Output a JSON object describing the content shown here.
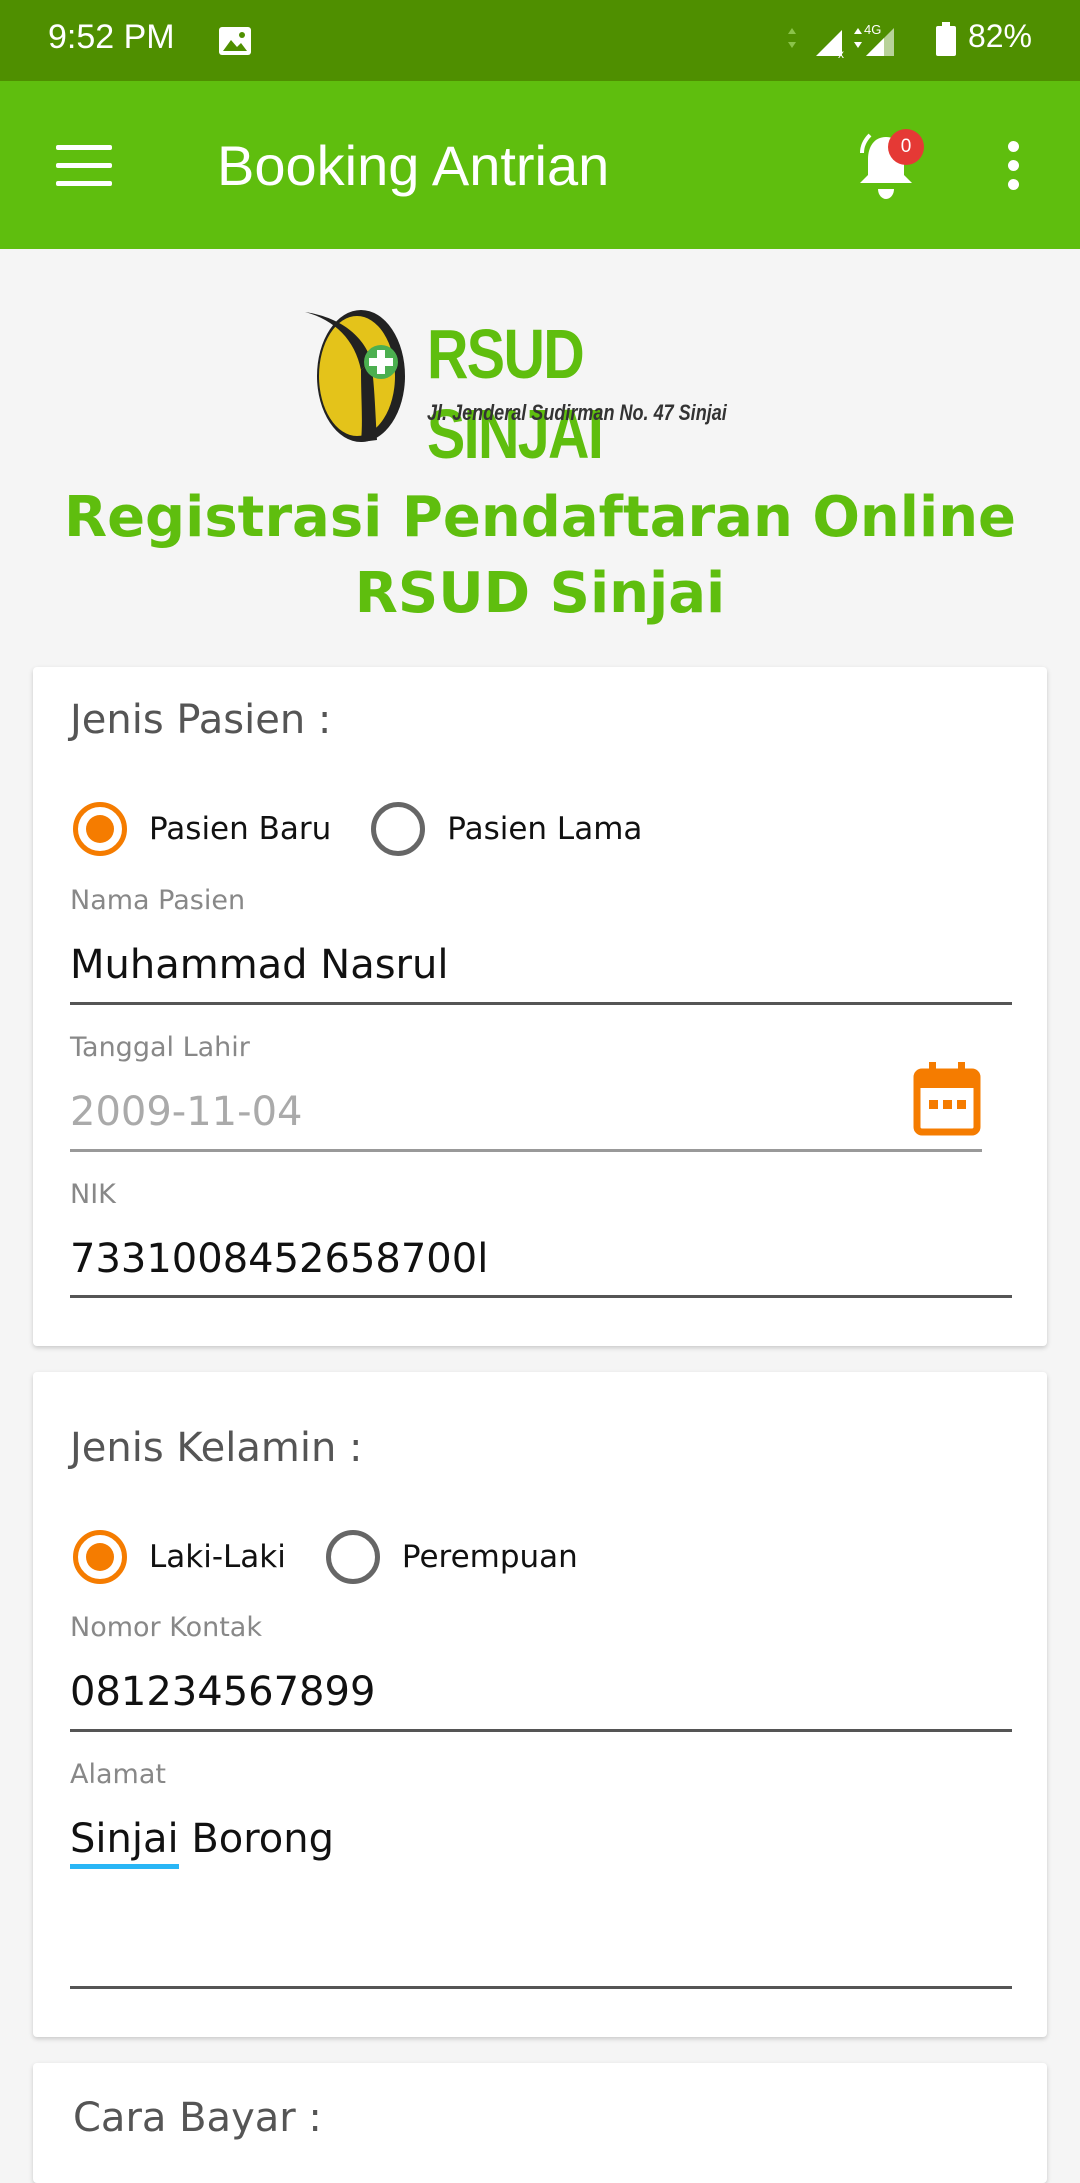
{
  "status_bar": {
    "time": "9:52 PM",
    "battery": "82%",
    "network": "4G",
    "icons": [
      "image-icon",
      "signal-icon",
      "battery-icon"
    ]
  },
  "app_bar": {
    "title": "Booking Antrian",
    "notification_count": "0",
    "icons": [
      "menu-icon",
      "bell-icon",
      "more-vert-icon"
    ]
  },
  "logo": {
    "name": "RSUD SINJAI",
    "address": "Jl. Jenderal Sudirman No. 47 Sinjai"
  },
  "heading": "Registrasi Pendaftaran Online RSUD Sinjai",
  "colors": {
    "primary": "#5fbe0e",
    "status_bar": "#4f8f00",
    "accent": "#f57c00"
  },
  "card1": {
    "label": "Jenis Pasien :",
    "options": [
      "Pasien Baru",
      "Pasien Lama"
    ],
    "selected": "Pasien Baru",
    "fields": {
      "nama_label": "Nama Pasien",
      "nama_value": "Muhammad Nasrul",
      "tanggal_label": "Tanggal Lahir",
      "tanggal_value": "2009-11-04",
      "nik_label": "NIK",
      "nik_value": "7331008452658700l"
    }
  },
  "card2": {
    "label": "Jenis Kelamin :",
    "options": [
      "Laki-Laki",
      "Perempuan"
    ],
    "selected": "Laki-Laki",
    "fields": {
      "kontak_label": "Nomor Kontak",
      "kontak_value": "081234567899",
      "alamat_label": "Alamat",
      "alamat_value_word1": "Sinjai",
      "alamat_value_word2": "Borong"
    }
  },
  "card3": {
    "label": "Cara Bayar :"
  }
}
